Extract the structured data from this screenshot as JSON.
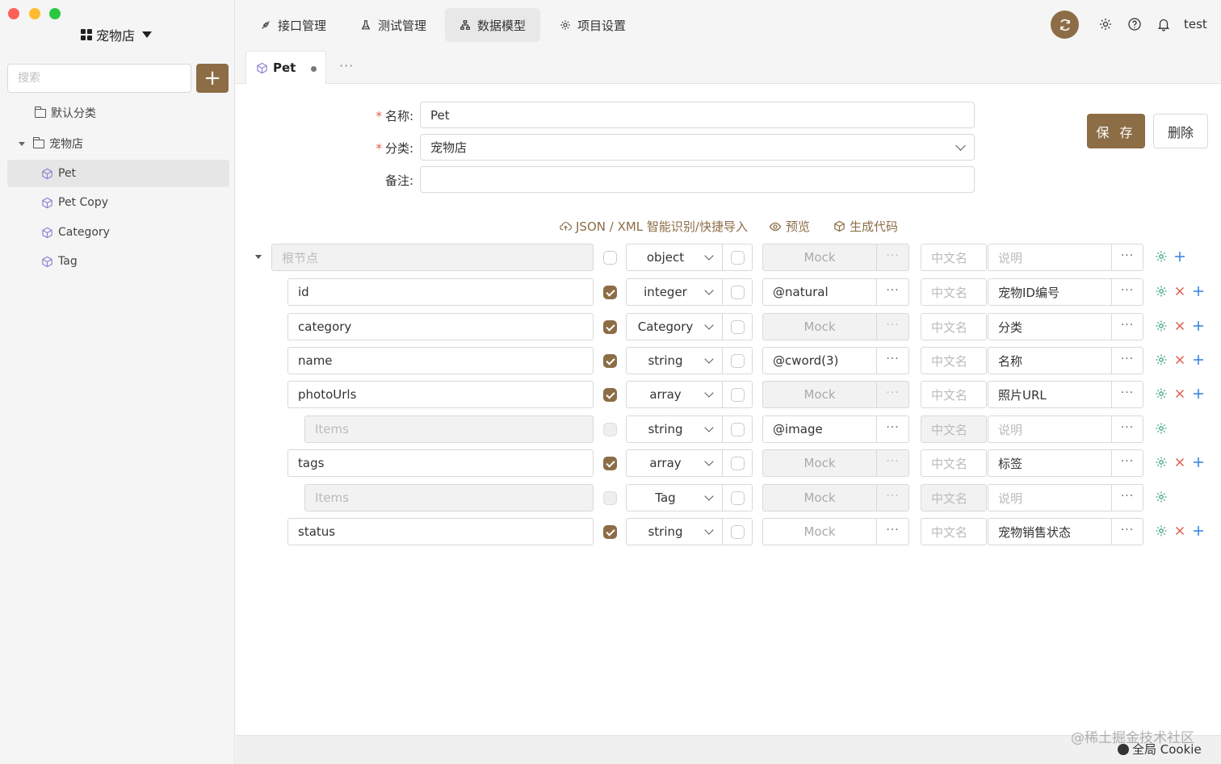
{
  "sidebar": {
    "project_name": "宠物店",
    "search_placeholder": "搜索",
    "add_label": "+",
    "tree": [
      {
        "label": "默认分类"
      },
      {
        "label": "宠物店"
      },
      {
        "label": "Pet"
      },
      {
        "label": "Pet Copy"
      },
      {
        "label": "Category"
      },
      {
        "label": "Tag"
      }
    ]
  },
  "topnav": {
    "tabs": [
      {
        "label": "接口管理"
      },
      {
        "label": "测试管理"
      },
      {
        "label": "数据模型"
      },
      {
        "label": "项目设置"
      }
    ],
    "user": "test"
  },
  "doc_tab": {
    "label": "Pet",
    "more": "···"
  },
  "form": {
    "name_label": "名称:",
    "name_value": "Pet",
    "category_label": "分类:",
    "category_value": "宠物店",
    "remark_label": "备注:",
    "remark_value": "",
    "required_mark": "*",
    "save_label": "保 存",
    "delete_label": "删除"
  },
  "tools": {
    "import": "JSON / XML 智能识别/快捷导入",
    "preview": "预览",
    "codegen": "生成代码"
  },
  "schema": {
    "more": "···",
    "rows": [
      {
        "name": "根节点",
        "type": "object",
        "mock": "Mock",
        "cn": "中文名",
        "desc": "说明"
      },
      {
        "name": "id",
        "type": "integer",
        "mock": "@natural",
        "cn": "中文名",
        "desc": "宠物ID编号"
      },
      {
        "name": "category",
        "type": "Category",
        "mock": "Mock",
        "cn": "中文名",
        "desc": "分类"
      },
      {
        "name": "name",
        "type": "string",
        "mock": "@cword(3)",
        "cn": "中文名",
        "desc": "名称"
      },
      {
        "name": "photoUrls",
        "type": "array",
        "mock": "Mock",
        "cn": "中文名",
        "desc": "照片URL"
      },
      {
        "name": "Items",
        "type": "string",
        "mock": "@image",
        "cn": "中文名",
        "desc": "说明"
      },
      {
        "name": "tags",
        "type": "array",
        "mock": "Mock",
        "cn": "中文名",
        "desc": "标签"
      },
      {
        "name": "Items",
        "type": "Tag",
        "mock": "Mock",
        "cn": "中文名",
        "desc": "说明"
      },
      {
        "name": "status",
        "type": "string",
        "mock": "Mock",
        "cn": "中文名",
        "desc": "宠物销售状态"
      }
    ]
  },
  "footer": {
    "watermark": "@稀土掘金技术社区",
    "cookie": "全局 Cookie"
  },
  "colors": {
    "accent": "#8c6d46",
    "required": "#e05a4b",
    "settings_icon": "#3aa37b",
    "delete_icon": "#e05a4b",
    "add_icon": "#2f7fe0"
  }
}
